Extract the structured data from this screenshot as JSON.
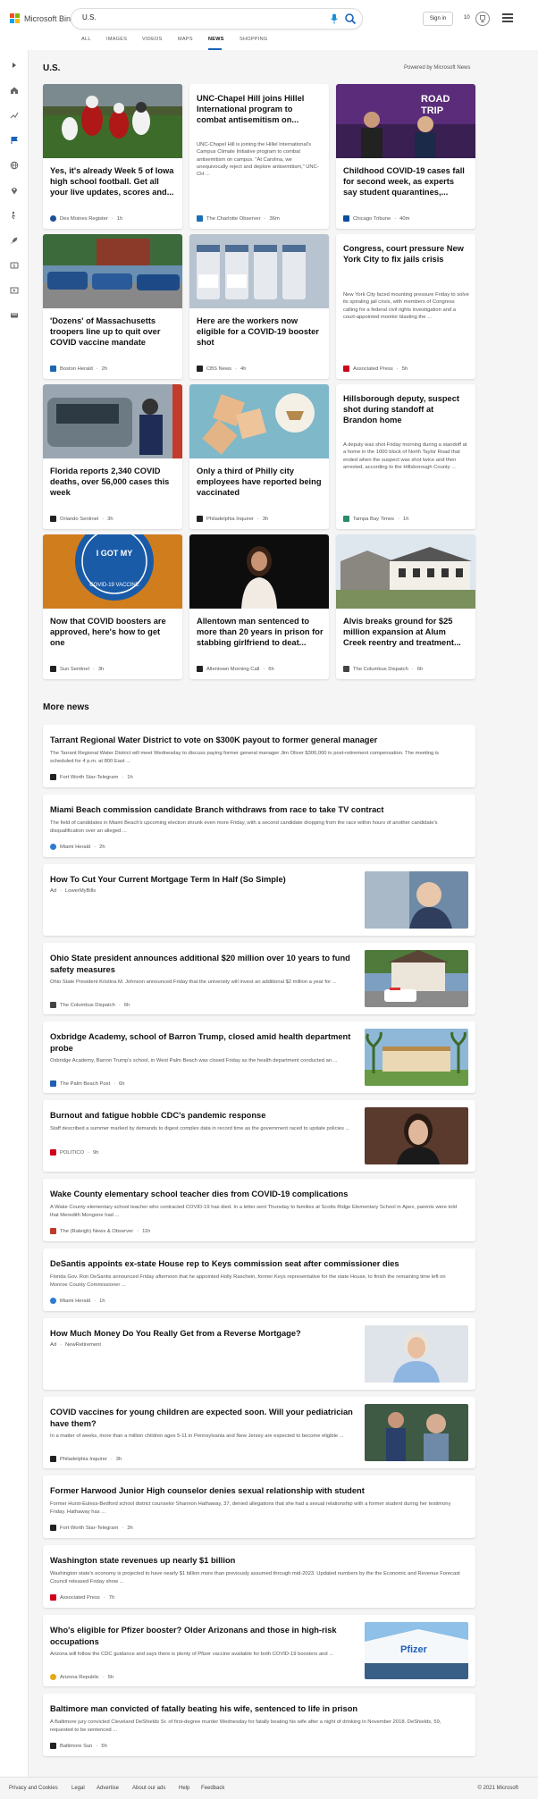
{
  "header": {
    "logo_text": "Microsoft Bing",
    "search_value": "U.S.",
    "signin": "Sign in",
    "points": "10",
    "brand_colors": [
      "#f25022",
      "#7fba00",
      "#00a4ef",
      "#ffb900"
    ]
  },
  "tabs": [
    "ALL",
    "IMAGES",
    "VIDEOS",
    "MAPS",
    "NEWS",
    "SHOPPING"
  ],
  "active_tab": "NEWS",
  "section_title": "U.S.",
  "powered_by": "Powered by Microsoft News",
  "cards": [
    {
      "title": "Yes, it's already Week 5 of Iowa high school football. Get all your live updates, scores and...",
      "snippet": "",
      "source": "Des Moines Register",
      "time": "1h",
      "logo_color": "#1f4e9a"
    },
    {
      "title": "UNC-Chapel Hill joins Hillel International program to combat antisemitism on...",
      "snippet": "UNC-Chapel Hill is joining the Hillel International's Campus Climate Initiative program to combat antisemitism on campus. \"At Carolina, we unequivocally reject and deplore antisemitism,\" UNC-CH ...",
      "source": "The Charlotte Observer",
      "time": "36m",
      "logo_color": "#1c6fb4"
    },
    {
      "title": "Childhood COVID-19 cases fall for second week, as experts say student quarantines,...",
      "snippet": "",
      "source": "Chicago Tribune",
      "time": "40m",
      "logo_color": "#0b4ea2"
    },
    {
      "title": "'Dozens' of Massachusetts troopers line up to quit over COVID vaccine mandate",
      "snippet": "",
      "source": "Boston Herald",
      "time": "2h",
      "logo_color": "#1e66b0"
    },
    {
      "title": "Here are the workers now eligible for a COVID-19 booster shot",
      "snippet": "",
      "source": "CBS News",
      "time": "4h",
      "logo_color": "#222222"
    },
    {
      "title": "Congress, court pressure New York City to fix jails crisis",
      "snippet": "New York City faced mounting pressure Friday to solve its spiraling jail crisis, with members of Congress calling for a federal civil rights investigation and a court-appointed monitor blasting the ...",
      "source": "Associated Press",
      "time": "5h",
      "logo_color": "#d0021b"
    },
    {
      "title": "Florida reports 2,340 COVID deaths, over 56,000 cases this week",
      "snippet": "",
      "source": "Orlando Sentinel",
      "time": "3h",
      "logo_color": "#222222"
    },
    {
      "title": "Only a third of Philly city employees have reported being vaccinated",
      "snippet": "",
      "source": "Philadelphia Inquirer",
      "time": "3h",
      "logo_color": "#222222"
    },
    {
      "title": "Hillsborough deputy, suspect shot during standoff at Brandon home",
      "snippet": "A deputy was shot Friday morning during a standoff at a home in the 1000 block of North Taylor Road that ended when the suspect was shot twice and then arrested, according to the Hillsborough County ...",
      "source": "Tampa Bay Times",
      "time": "1h",
      "logo_color": "#2a8a6a"
    },
    {
      "title": "Now that COVID boosters are approved, here's how to get one",
      "snippet": "",
      "source": "Sun Sentinel",
      "time": "3h",
      "logo_color": "#222222"
    },
    {
      "title": "Allentown man sentenced to more than 20 years in prison for stabbing girlfriend to deat...",
      "snippet": "",
      "source": "Allentown Morning Call",
      "time": "6h",
      "logo_color": "#222222"
    },
    {
      "title": "Alvis breaks ground for $25 million expansion at Alum Creek reentry and treatment...",
      "snippet": "",
      "source": "The Columbus Dispatch",
      "time": "6h",
      "logo_color": "#444444"
    }
  ],
  "more_news_title": "More news",
  "more_news": [
    {
      "title": "Tarrant Regional Water District to vote on $300K payout to former general manager",
      "snippet": "The Tarrant Regional Water District will meet Wednesday to discuss paying former general manager Jim Oliver $300,000 in post-retirement compensation. The meeting is scheduled for 4 p.m. at 800 East ...",
      "source": "Fort Worth Star-Telegram",
      "time": "1h",
      "ad": false,
      "logo_color": "#222222"
    },
    {
      "title": "Miami Beach commission candidate Branch withdraws from race to take TV contract",
      "snippet": "The field of candidates in Miami Beach's upcoming election shrunk even more Friday, with a second candidate dropping from the race within hours of another candidate's disqualification over an alleged ...",
      "source": "Miami Herald",
      "time": "2h",
      "ad": false,
      "logo_color": "#2b7bd1"
    },
    {
      "title": "How To Cut Your Current Mortgage Term In Half (So Simple)",
      "snippet": "",
      "source": "LowerMyBills",
      "time": "",
      "ad": true,
      "ad_label": "Ad",
      "logo_color": ""
    },
    {
      "title": "Ohio State president announces additional $20 million over 10 years to fund safety measures",
      "snippet": "Ohio State President Kristina M. Johnson announced Friday that the university will invest an additional $2 million a year for ...",
      "source": "The Columbus Dispatch",
      "time": "6h",
      "ad": false,
      "logo_color": "#444444"
    },
    {
      "title": "Oxbridge Academy, school of Barron Trump, closed amid health department probe",
      "snippet": "Oxbridge Academy, Barron Trump's school, in West Palm Beach was closed Friday as the health department conducted an ...",
      "source": "The Palm Beach Post",
      "time": "6h",
      "ad": false,
      "logo_color": "#2160b0"
    },
    {
      "title": "Burnout and fatigue hobble CDC's pandemic response",
      "snippet": "Staff described a summer marked by demands to digest complex data in record time as the government raced to update policies ...",
      "source": "POLITICO",
      "time": "9h",
      "ad": false,
      "logo_color": "#d0021b"
    },
    {
      "title": "Wake County elementary school teacher dies from COVID-19 complications",
      "snippet": "A Wake County elementary school teacher who contracted COVID-19 has died. In a letter sent Thursday to families at Scotts Ridge Elementary School in Apex, parents were told that Meredith Mongone had ...",
      "source": "The (Raleigh) News & Observer",
      "time": "11h",
      "ad": false,
      "logo_color": "#c0392b"
    },
    {
      "title": "DeSantis appoints ex-state House rep to Keys commission seat after commissioner dies",
      "snippet": "Florida Gov. Ron DeSantis announced Friday afternoon that he appointed Holly Raschein, former Keys representative for the state House, to finish the remaining time left on Monroe County Commissioner ...",
      "source": "Miami Herald",
      "time": "1h",
      "ad": false,
      "logo_color": "#2b7bd1"
    },
    {
      "title": "How Much Money Do You Really Get from a Reverse Mortgage?",
      "snippet": "",
      "source": "NewRetirement",
      "time": "",
      "ad": true,
      "ad_label": "Ad",
      "logo_color": ""
    },
    {
      "title": "COVID vaccines for young children are expected soon. Will your pediatrician have them?",
      "snippet": "In a matter of weeks, more than a million children ages 5-11 in Pennsylvania and New Jersey are expected to become eligible ...",
      "source": "Philadelphia Inquirer",
      "time": "3h",
      "ad": false,
      "logo_color": "#222222"
    },
    {
      "title": "Former Harwood Junior High counselor denies sexual relationship with student",
      "snippet": "Former Hurst-Euless-Bedford school district counselor Shannon Hathaway, 37, denied allegations that she had a sexual relationship with a former student during her testimony Friday. Hathaway has ...",
      "source": "Fort Worth Star-Telegram",
      "time": "3h",
      "ad": false,
      "logo_color": "#222222"
    },
    {
      "title": "Washington state revenues up nearly $1 billion",
      "snippet": "Washington state's economy is projected to have nearly $1 billion more than previously assumed through mid-2023. Updated numbers by the the Economic and Revenue Forecast Council released Friday show ...",
      "source": "Associated Press",
      "time": "7h",
      "ad": false,
      "logo_color": "#d0021b"
    },
    {
      "title": "Who's eligible for Pfizer booster? Older Arizonans and those in high-risk occupations",
      "snippet": "Arizona will follow the CDC guidance and says there is plenty of Pfizer vaccine available for both COVID-19 boosters and ...",
      "source": "Arizona Republic",
      "time": "5h",
      "ad": false,
      "logo_color": "#e6a817"
    },
    {
      "title": "Baltimore man convicted of fatally beating his wife, sentenced to life in prison",
      "snippet": "A Baltimore jury convicted Cleveland DeShields Sr. of first-degree murder Wednesday for fatally beating his wife after a night of drinking in November 2018. DeShields, 59, requested to be sentenced ...",
      "source": "Baltimore Sun",
      "time": "5h",
      "ad": false,
      "logo_color": "#222222"
    }
  ],
  "footer": {
    "links": [
      "Privacy and Cookies",
      "Legal",
      "Advertise",
      "About our ads",
      "Help",
      "Feedback"
    ],
    "copyright": "© 2021 Microsoft"
  }
}
